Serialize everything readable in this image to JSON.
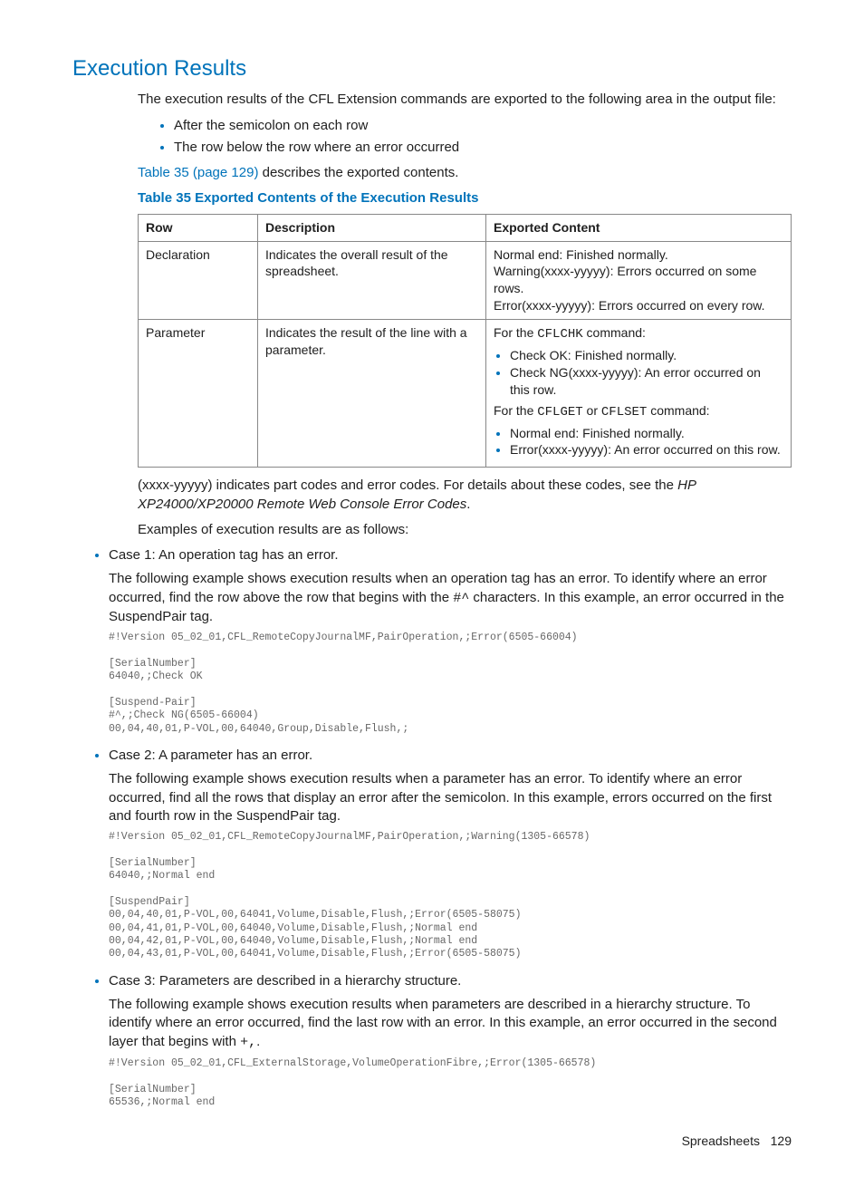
{
  "section": {
    "title": "Execution Results",
    "intro": "The execution results of the CFL Extension commands are exported to the following area in the output file:",
    "bullets": [
      "After the semicolon on each row",
      "The row below the row where an error occurred"
    ],
    "xref_link": "Table 35 (page 129)",
    "xref_after": " describes the exported contents.",
    "table_caption": "Table 35 Exported Contents of the Execution Results",
    "table": {
      "headers": [
        "Row",
        "Description",
        "Exported Content"
      ],
      "rows": [
        {
          "row": "Declaration",
          "desc": "Indicates the overall result of the spreadsheet.",
          "exp_lines": [
            "Normal end: Finished normally.",
            "Warning(xxxx-yyyyy): Errors occurred on some rows.",
            "Error(xxxx-yyyyy): Errors occurred on every row."
          ]
        },
        {
          "row": "Parameter",
          "desc": "Indicates the result of the line with a parameter.",
          "exp_pre1": "For the ",
          "exp_cmd1": "CFLCHK",
          "exp_post1": " command:",
          "exp_list1": [
            "Check OK: Finished normally.",
            "Check NG(xxxx-yyyyy): An error occurred on this row."
          ],
          "exp_pre2": "For the ",
          "exp_cmd2a": "CFLGET",
          "exp_or": " or ",
          "exp_cmd2b": "CFLSET",
          "exp_post2": " command:",
          "exp_list2": [
            "Normal end: Finished normally.",
            "Error(xxxx-yyyyy): An error occurred on this row."
          ]
        }
      ]
    },
    "note_pre": "(xxxx-yyyyy) indicates part codes and error codes. For details about these codes, see the ",
    "note_italic": "HP XP24000/XP20000 Remote Web Console Error Codes",
    "note_post": ".",
    "examples_intro": "Examples of execution results are as follows:",
    "cases": [
      {
        "title": "Case 1: An operation tag has an error.",
        "desc_pre": "The following example shows execution results when an operation tag has an error. To identify where an error occurred, find the row above the row that begins with the ",
        "desc_code": "#^",
        "desc_post": " characters. In this example, an error occurred in the SuspendPair tag.",
        "code": "#!Version 05_02_01,CFL_RemoteCopyJournalMF,PairOperation,;Error(6505-66004)\n\n[SerialNumber]\n64040,;Check OK\n\n[Suspend-Pair]\n#^,;Check NG(6505-66004)\n00,04,40,01,P-VOL,00,64040,Group,Disable,Flush,;"
      },
      {
        "title": "Case 2: A parameter has an error.",
        "desc_pre": "The following example shows execution results when a parameter has an error. To identify where an error occurred, find all the rows that display an error after the semicolon. In this example, errors occurred on the first and fourth row in the SuspendPair tag.",
        "desc_code": "",
        "desc_post": "",
        "code": "#!Version 05_02_01,CFL_RemoteCopyJournalMF,PairOperation,;Warning(1305-66578)\n\n[SerialNumber]\n64040,;Normal end\n\n[SuspendPair]\n00,04,40,01,P-VOL,00,64041,Volume,Disable,Flush,;Error(6505-58075)\n00,04,41,01,P-VOL,00,64040,Volume,Disable,Flush,;Normal end\n00,04,42,01,P-VOL,00,64040,Volume,Disable,Flush,;Normal end\n00,04,43,01,P-VOL,00,64041,Volume,Disable,Flush,;Error(6505-58075)"
      },
      {
        "title": "Case 3: Parameters are described in a hierarchy structure.",
        "desc_pre": "The following example shows execution results when parameters are described in a hierarchy structure. To identify where an error occurred, find the last row with an error. In this example, an error occurred in the second layer that begins with ",
        "desc_code": "+,",
        "desc_post": ".",
        "code": "#!Version 05_02_01,CFL_ExternalStorage,VolumeOperationFibre,;Error(1305-66578)\n\n[SerialNumber]\n65536,;Normal end"
      }
    ]
  },
  "footer": {
    "section_name": "Spreadsheets",
    "page": "129"
  }
}
